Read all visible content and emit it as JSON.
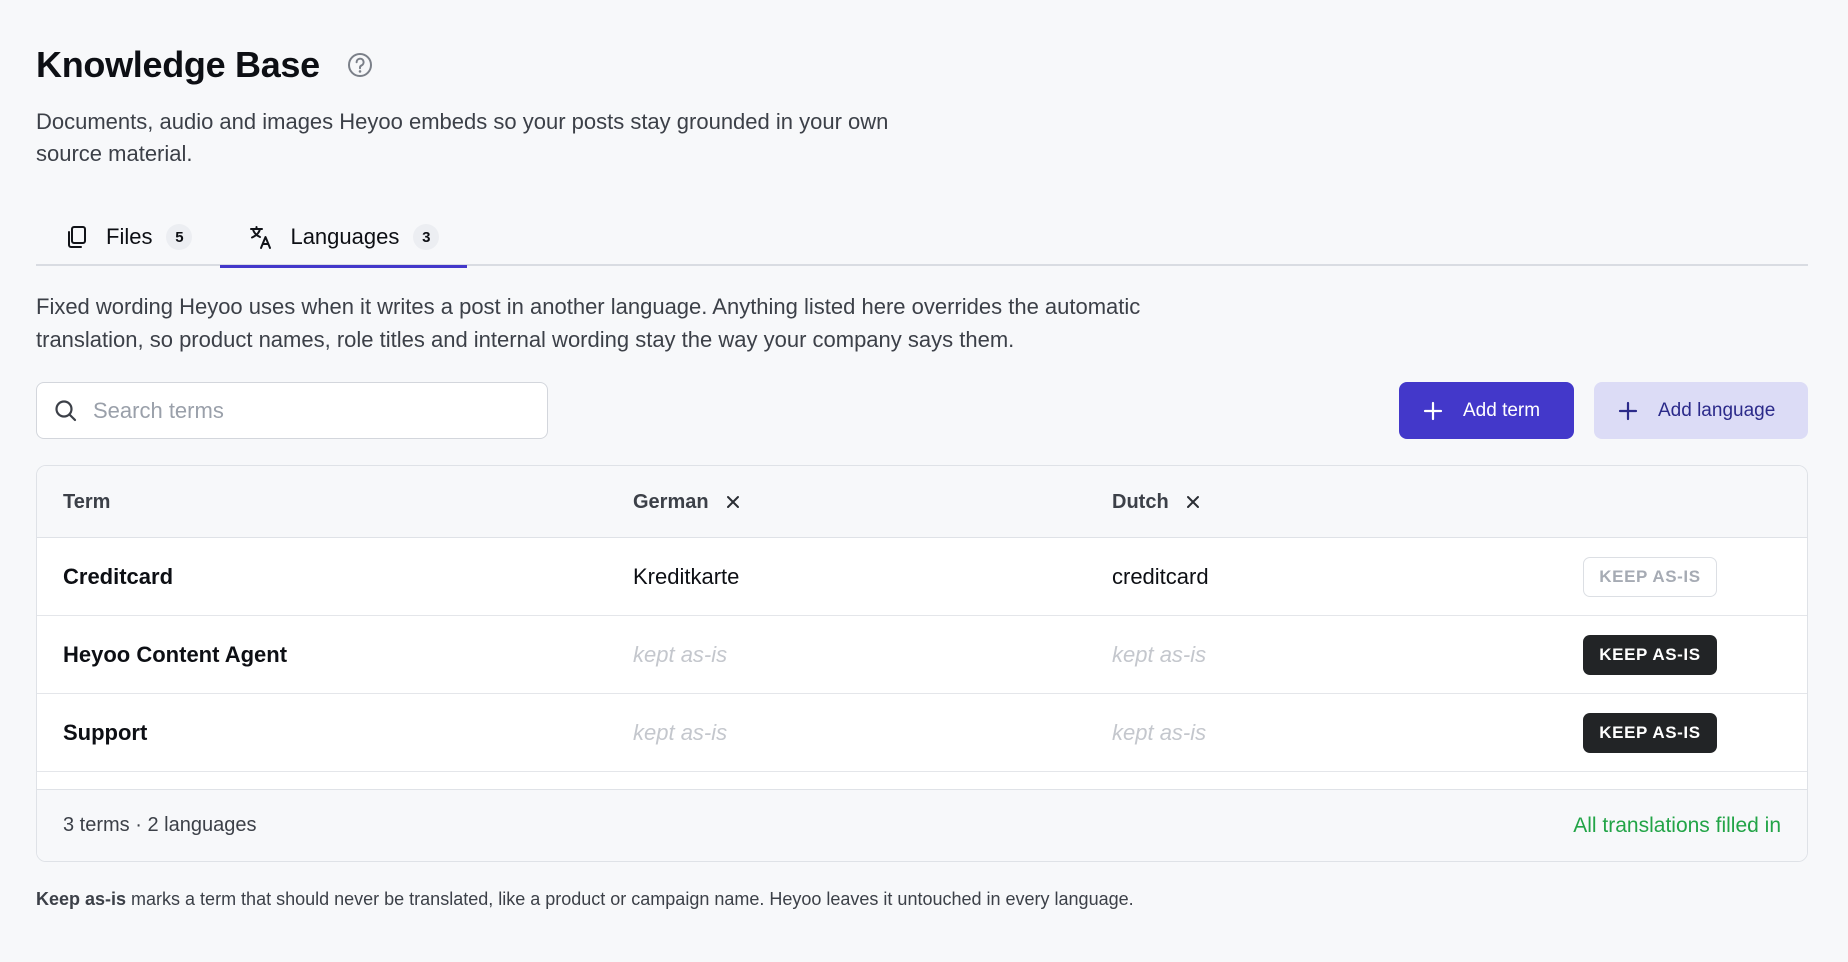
{
  "header": {
    "title": "Knowledge Base",
    "subtitle": "Documents, audio and images Heyoo embeds so your posts stay grounded in your own source material."
  },
  "tabs": [
    {
      "label": "Files",
      "count": "5",
      "icon": "files-icon",
      "active": false
    },
    {
      "label": "Languages",
      "count": "3",
      "icon": "translate-icon",
      "active": true
    }
  ],
  "description": "Fixed wording Heyoo uses when it writes a post in another language. Anything listed here overrides the automatic translation, so product names, role titles and internal wording stay the way your company says them.",
  "search": {
    "placeholder": "Search terms",
    "value": ""
  },
  "buttons": {
    "add_term": "Add term",
    "add_language": "Add language"
  },
  "table": {
    "columns": {
      "term": "Term",
      "lang1": "German",
      "lang2": "Dutch"
    },
    "rows": [
      {
        "term": "Creditcard",
        "german": "Kreditkarte",
        "dutch": "creditcard",
        "keep_label": "KEEP AS-IS",
        "keep_active": false
      },
      {
        "term": "Heyoo Content Agent",
        "german": "kept as-is",
        "dutch": "kept as-is",
        "keep_label": "KEEP AS-IS",
        "keep_active": true
      },
      {
        "term": "Support",
        "german": "kept as-is",
        "dutch": "kept as-is",
        "keep_label": "KEEP AS-IS",
        "keep_active": true
      }
    ],
    "footer": {
      "summary": "3 terms · 2 languages",
      "status": "All translations filled in"
    }
  },
  "note": {
    "bold": "Keep as-is",
    "text": " marks a term that should never be translated, like a product or campaign name. Heyoo leaves it untouched in every language."
  },
  "colors": {
    "accent": "#4338ca",
    "accent_soft": "#dcdcf6",
    "success": "#22a447",
    "keep_on": "#222426"
  }
}
